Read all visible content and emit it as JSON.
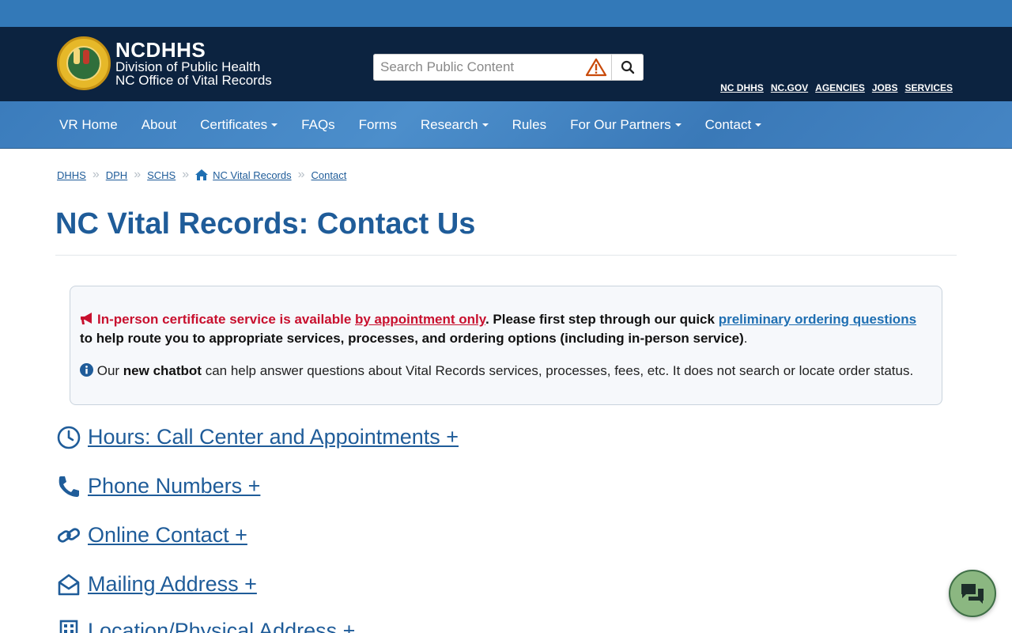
{
  "header": {
    "org": "NCDHHS",
    "division": "Division of Public Health",
    "office": "NC Office of Vital Records",
    "search_placeholder": "Search Public Content",
    "util_links": [
      "NC DHHS",
      "NC.GOV",
      "AGENCIES",
      "JOBS",
      "SERVICES"
    ]
  },
  "nav": {
    "items": [
      {
        "label": "VR Home",
        "dropdown": false
      },
      {
        "label": "About",
        "dropdown": false
      },
      {
        "label": "Certificates",
        "dropdown": true
      },
      {
        "label": "FAQs",
        "dropdown": false
      },
      {
        "label": "Forms",
        "dropdown": false
      },
      {
        "label": "Research",
        "dropdown": true
      },
      {
        "label": "Rules",
        "dropdown": false
      },
      {
        "label": "For Our Partners",
        "dropdown": true
      },
      {
        "label": "Contact",
        "dropdown": true
      }
    ]
  },
  "breadcrumb": [
    "DHHS",
    "DPH",
    "SCHS",
    "NC Vital Records",
    "Contact"
  ],
  "page_title": "NC Vital Records: Contact Us",
  "alert": {
    "red_text": "In-person certificate service is available ",
    "red_link": "by appointment only",
    "bold_text": ". Please first step through our quick ",
    "link": "preliminary ordering questions",
    "bold_text2": " to help route you to appropriate services, processes, and ordering options (including in-person service)",
    "period": ".",
    "info_prefix": " Our ",
    "info_bold": "new chatbot",
    "info_rest": " can help answer questions about Vital Records services, processes, fees, etc. It does not search or locate order status."
  },
  "sections": [
    {
      "label": "Hours: Call Center and Appointments +",
      "icon": "clock-icon"
    },
    {
      "label": "Phone Numbers +",
      "icon": "phone-icon"
    },
    {
      "label": "Online Contact +",
      "icon": "link-icon"
    },
    {
      "label": "Mailing Address +",
      "icon": "envelope-icon"
    },
    {
      "label": "Location/Physical Address +",
      "icon": "building-icon"
    }
  ],
  "colors": {
    "top_strip": "#3379b8",
    "header_bg": "#0c2340",
    "nav_bg": "#3d7fbf",
    "title": "#1f5c99",
    "alert_red": "#c8102e",
    "chat_bg": "#8bb781"
  }
}
